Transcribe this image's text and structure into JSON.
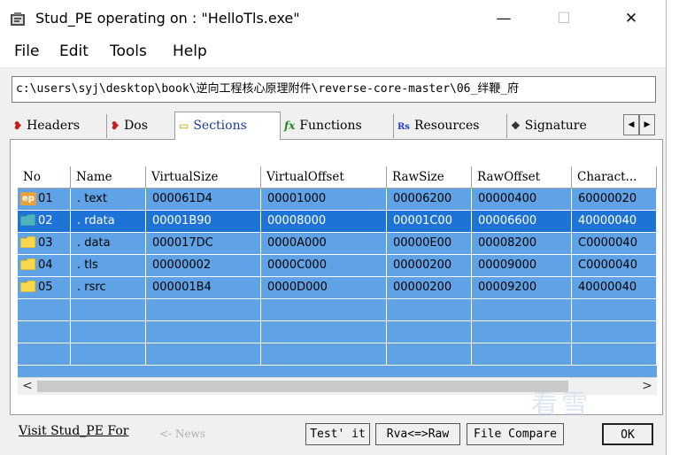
{
  "window": {
    "title": "Stud_PE operating on : \"HelloTls.exe\"",
    "app_icon": "stud-pe-app-icon",
    "controls": {
      "minimize": "—",
      "maximize": "☐",
      "close": "✕"
    }
  },
  "menu": [
    "File",
    "Edit",
    "Tools",
    "Help"
  ],
  "path": "c:\\users\\syj\\desktop\\book\\逆向工程核心原理附件\\reverse-core-master\\06_绊鞭_府",
  "tabs": [
    {
      "label": "Headers",
      "icon": "headers-icon",
      "glyph": "❥"
    },
    {
      "label": "Dos",
      "icon": "dos-icon",
      "glyph": "❥"
    },
    {
      "label": "Sections",
      "icon": "sections-icon",
      "glyph": "▭"
    },
    {
      "label": "Functions",
      "icon": "functions-icon",
      "glyph": "fx"
    },
    {
      "label": "Resources",
      "icon": "resources-icon",
      "glyph": "Rs"
    },
    {
      "label": "Signature",
      "icon": "signature-icon",
      "glyph": "❖"
    }
  ],
  "active_tab": "Sections",
  "tab_scroll": {
    "left": "◀",
    "right": "▶"
  },
  "table": {
    "columns": [
      "No",
      "Name",
      "VirtualSize",
      "VirtualOffset",
      "RawSize",
      "RawOffset",
      "Charact..."
    ],
    "rows": [
      {
        "no": "01",
        "name": ". text",
        "vsize": "000061D4",
        "voffset": "00001000",
        "rsize": "00006200",
        "roffset": "00000400",
        "charact": "60000020",
        "icon": "ep"
      },
      {
        "no": "02",
        "name": ". rdata",
        "vsize": "00001B90",
        "voffset": "00008000",
        "rsize": "00001C00",
        "roffset": "00006600",
        "charact": "40000040",
        "icon": "folder"
      },
      {
        "no": "03",
        "name": ". data",
        "vsize": "000017DC",
        "voffset": "0000A000",
        "rsize": "00000E00",
        "roffset": "00008200",
        "charact": "C0000040",
        "icon": "folder"
      },
      {
        "no": "04",
        "name": ". tls",
        "vsize": "00000002",
        "voffset": "0000C000",
        "rsize": "00000200",
        "roffset": "00009000",
        "charact": "C0000040",
        "icon": "folder"
      },
      {
        "no": "05",
        "name": ". rsrc",
        "vsize": "000001B4",
        "voffset": "0000D000",
        "rsize": "00000200",
        "roffset": "00009200",
        "charact": "40000040",
        "icon": "folder"
      }
    ],
    "selected_row": "02",
    "ep_badge": "ep"
  },
  "scrollbar": {
    "left": "<",
    "right": ">"
  },
  "footer": {
    "link": "Visit Stud_PE For",
    "news": "<- News",
    "buttons": {
      "test": "Test' it",
      "rva": "Rva<=>Raw",
      "compare": "File Compare",
      "ok": "OK"
    }
  },
  "watermark": "看雪",
  "colors": {
    "grid_bg": "#5fa3e6",
    "selection": "#1e73d6",
    "folder": "#f7d84e",
    "ep_badge": "#e9a23b",
    "active_tab_text": "#1a3a9a"
  }
}
